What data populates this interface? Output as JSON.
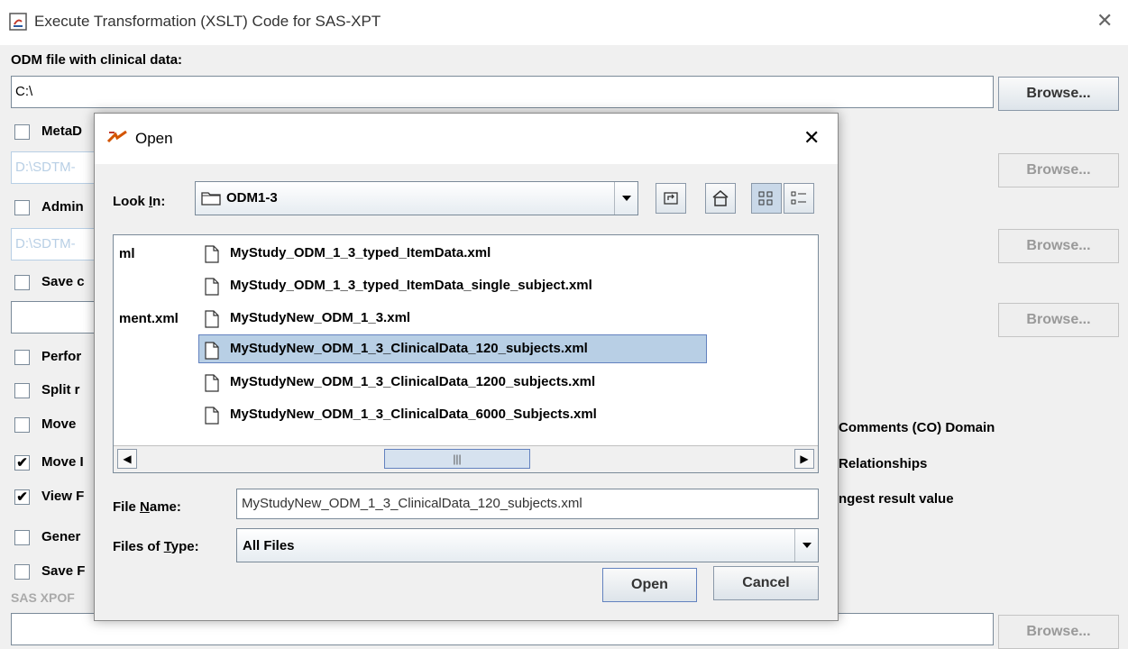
{
  "window": {
    "title": "Execute Transformation (XSLT) Code for SAS-XPT",
    "close_glyph": "✕"
  },
  "main": {
    "odm_label": "ODM file with clinical data:",
    "odm_value": "C:\\",
    "browse_label": "Browse...",
    "checkboxes": [
      {
        "label": "MetaD",
        "checked": false
      },
      {
        "label": "Admin",
        "checked": false
      },
      {
        "label": "Save c",
        "checked": false
      },
      {
        "label": "Perfor",
        "checked": false
      },
      {
        "label": "Split r",
        "checked": false
      },
      {
        "label": "Move",
        "checked": false
      },
      {
        "label": "Move I",
        "checked": true
      },
      {
        "label": "View F",
        "checked": true
      },
      {
        "label": "Gener",
        "checked": false
      },
      {
        "label": "Save F",
        "checked": false
      }
    ],
    "metadata_path": "D:\\SDTM-",
    "admin_path": "D:\\SDTM-",
    "right_texts": [
      "Comments (CO) Domain",
      "Relationships",
      "ngest result value"
    ],
    "sas_label": "SAS XPOF",
    "check_glyph": "✔"
  },
  "dialog": {
    "title": "Open",
    "close_glyph": "✕",
    "look_in_label": "Look In:",
    "look_in_value": "ODM1-3",
    "partial_items": [
      "ml",
      "ment.xml"
    ],
    "files": [
      "MyStudy_ODM_1_3_typed_ItemData.xml",
      "MyStudy_ODM_1_3_typed_ItemData_single_subject.xml",
      "MyStudyNew_ODM_1_3.xml",
      "MyStudyNew_ODM_1_3_ClinicalData_120_subjects.xml",
      "MyStudyNew_ODM_1_3_ClinicalData_1200_subjects.xml",
      "MyStudyNew_ODM_1_3_ClinicalData_6000_Subjects.xml"
    ],
    "selected_index": 3,
    "file_name_label": "File Name:",
    "file_name_value": "MyStudyNew_ODM_1_3_ClinicalData_120_subjects.xml",
    "files_of_type_label": "Files of Type:",
    "files_of_type_value": "All Files",
    "open_label": "Open",
    "cancel_label": "Cancel",
    "scroll_left_glyph": "◀",
    "scroll_right_glyph": "▶",
    "scroll_thumb_glyph": "|||"
  }
}
